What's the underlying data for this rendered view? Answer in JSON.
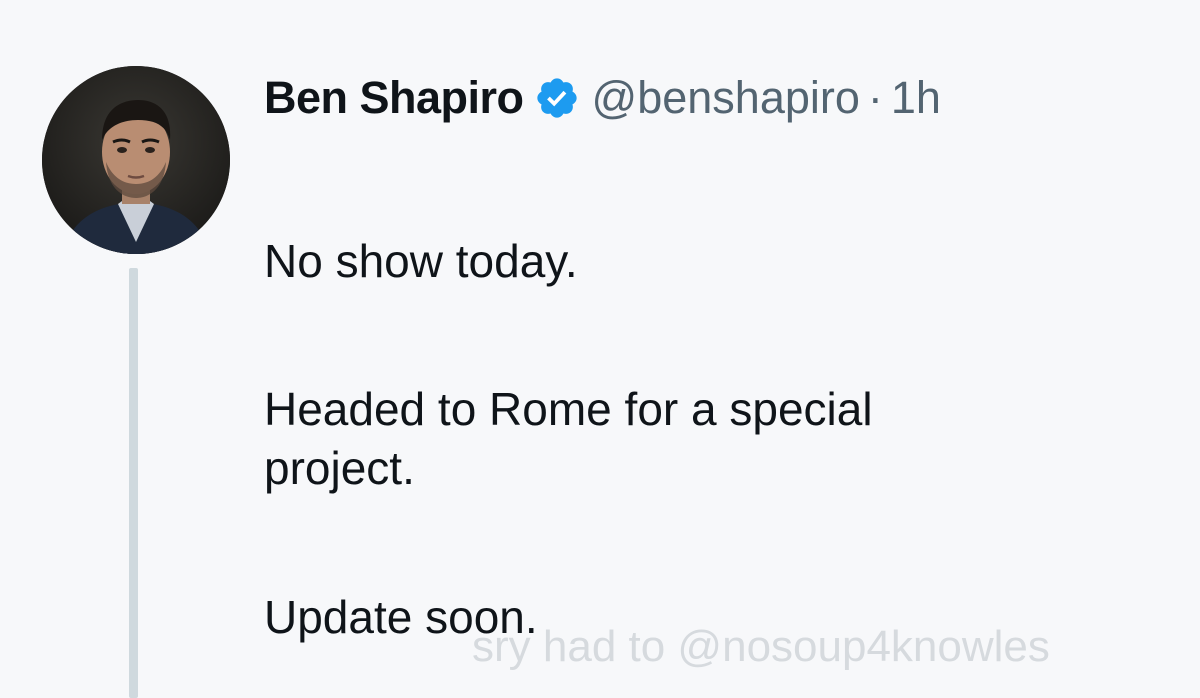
{
  "author": {
    "display_name": "Ben Shapiro",
    "handle": "@benshapiro",
    "separator": "·",
    "time": "1h",
    "verified": true,
    "verified_icon": "verified-badge-icon",
    "avatar": "profile-photo"
  },
  "tweet": {
    "paragraphs": [
      "No show today.",
      "Headed to Rome for a special\nproject.",
      "Update soon."
    ]
  },
  "overlay": {
    "watermark": "sry had to @nosoup4knowles"
  },
  "colors": {
    "background": "#f7f8fa",
    "text": "#0f1419",
    "secondary_text": "#536471",
    "verified": "#1d9bf0",
    "thread_line": "#cfd9de"
  }
}
